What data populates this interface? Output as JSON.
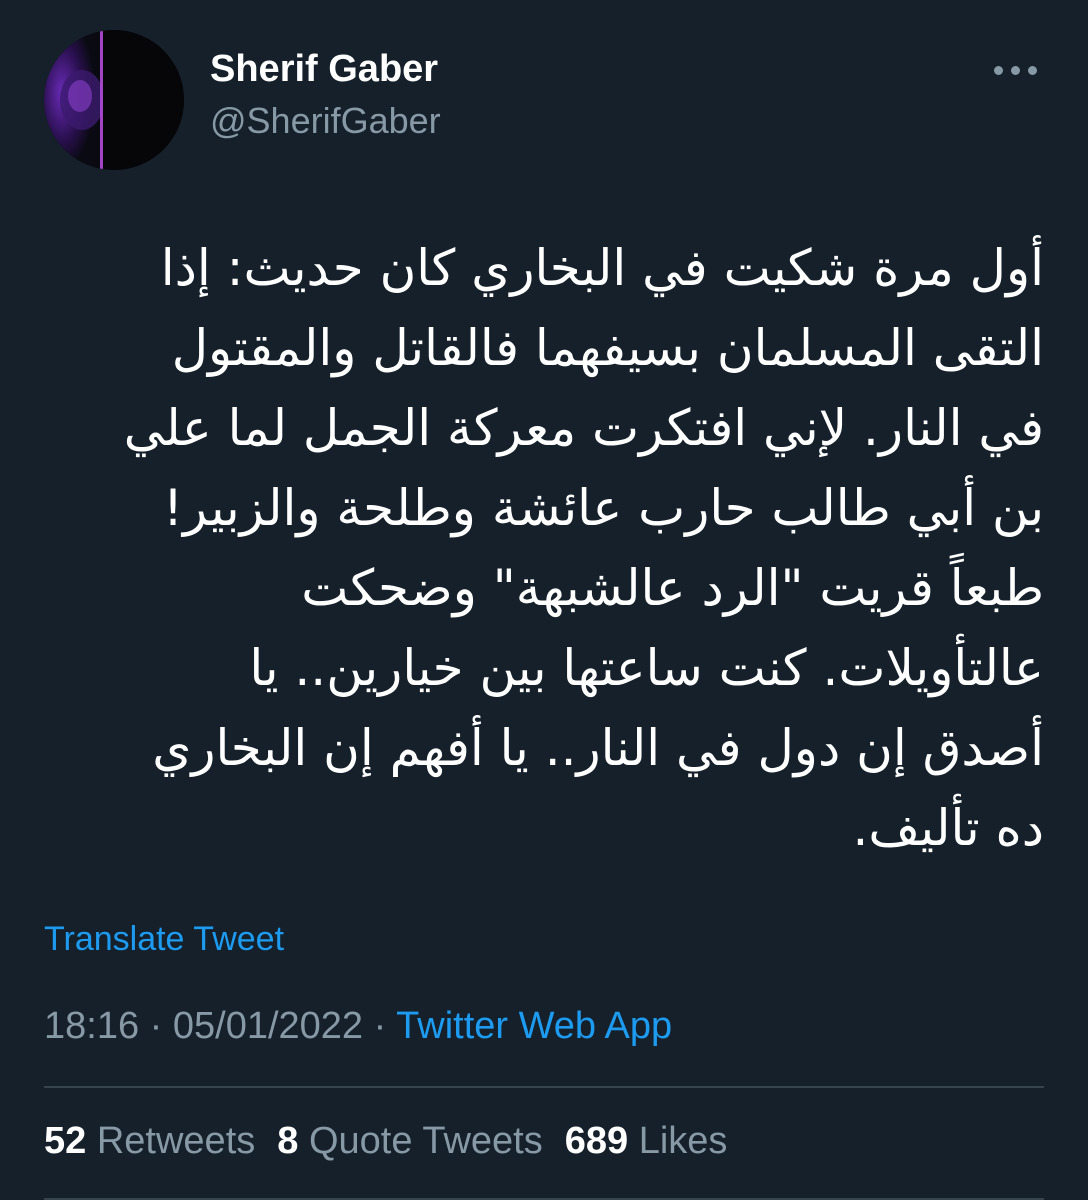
{
  "author": {
    "name": "Sherif Gaber",
    "handle": "@SherifGaber"
  },
  "icons": {
    "more": "more-horizontal-icon",
    "avatar": "profile-avatar"
  },
  "tweet": {
    "lines": [
      "أول مرة شكيت في البخاري كان حديث: إذا",
      "التقى المسلمان بسيفهما فالقاتل والمقتول",
      "في النار. لإني افتكرت معركة الجمل لما علي",
      "بن أبي طالب حارب عائشة وطلحة والزبير!",
      "طبعاً قريت \"الرد عالشبهة\" وضحكت",
      "عالتأويلات. كنت ساعتها بين خيارين.. يا",
      "أصدق إن دول في النار.. يا أفهم إن البخاري",
      "ده تأليف."
    ],
    "translate_label": "Translate Tweet",
    "time": "18:16",
    "date": "05/01/2022",
    "separator": "·",
    "source": "Twitter Web App"
  },
  "stats": {
    "retweets_count": "52",
    "retweets_label": "Retweets",
    "quotes_count": "8",
    "quotes_label": "Quote Tweets",
    "likes_count": "689",
    "likes_label": "Likes"
  },
  "colors": {
    "background": "#15202b",
    "text": "#ffffff",
    "secondary": "#8899a6",
    "accent": "#1d9bf0",
    "divider": "#38444d"
  }
}
